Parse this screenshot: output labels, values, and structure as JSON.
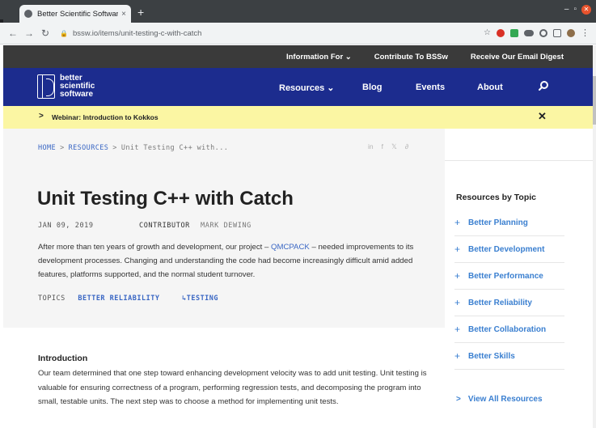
{
  "browser": {
    "tab_title": "Better Scientific Software",
    "tab_close": "×",
    "new_tab": "+",
    "url": "bssw.io/items/unit-testing-c-with-catch"
  },
  "utility_bar": {
    "items": [
      "Information For ⌄",
      "Contribute To BSSw",
      "Receive Our Email Digest"
    ]
  },
  "logo": {
    "line1": "better",
    "line2": "scientific",
    "line3": "software"
  },
  "main_nav": {
    "resources": "Resources ⌄",
    "blog": "Blog",
    "events": "Events",
    "about": "About"
  },
  "announcement": {
    "text": "Webinar: Introduction to Kokkos",
    "close": "✕"
  },
  "breadcrumb": {
    "home": "HOME",
    "resources": "RESOURCES",
    "current": "Unit Testing C++ with...",
    "sep": ">"
  },
  "share": [
    "in",
    "f",
    "𝕏",
    "∂"
  ],
  "article": {
    "title": "Unit Testing C++ with Catch",
    "date": "JAN 09, 2019",
    "contributor_label": "CONTRIBUTOR",
    "contributor_name": "MARK DEWING",
    "intro_before": "After more than ten years of growth and development, our project – ",
    "intro_link": "QMCPACK",
    "intro_after": " – needed improvements to its development processes. Changing and understanding the code had become increasingly difficult amid added features, platforms supported, and the normal student turnover.",
    "topics_label": "TOPICS",
    "topic_1": "BETTER RELIABILITY",
    "topic_2": "↳TESTING",
    "section_heading": "Introduction",
    "section_body": "Our team determined that one step toward enhancing development velocity was to add unit testing. Unit testing is valuable for ensuring correctness of a program, performing regression tests, and decomposing the program into small, testable units. The next step was to choose a method for implementing unit tests."
  },
  "sidebar": {
    "heading": "Resources by Topic",
    "plus": "+",
    "items": [
      "Better Planning",
      "Better Development",
      "Better Performance",
      "Better Reliability",
      "Better Collaboration",
      "Better Skills"
    ],
    "view_all": "View All Resources",
    "view_all_chev": ">"
  }
}
